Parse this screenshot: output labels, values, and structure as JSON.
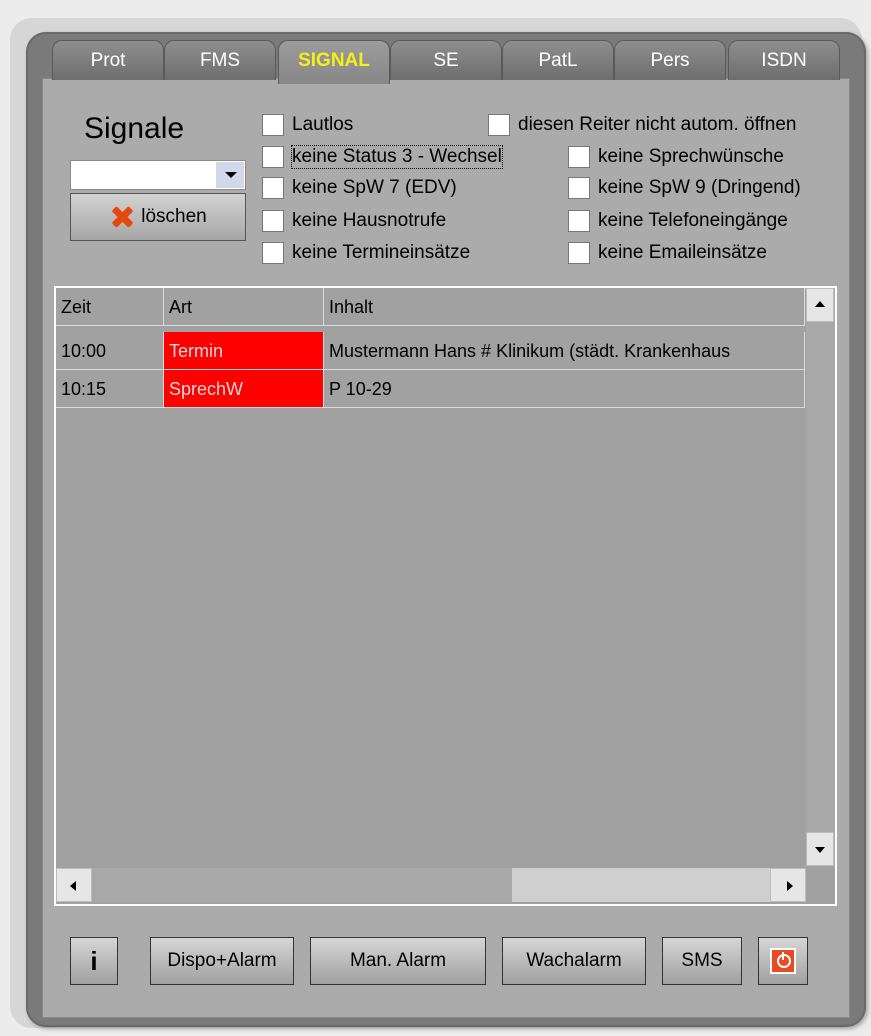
{
  "tabs": [
    "Prot",
    "FMS",
    "SIGNAL",
    "SE",
    "PatL",
    "Pers",
    "ISDN"
  ],
  "active_tab": "SIGNAL",
  "signal": {
    "title": "Signale",
    "dropdown_value": "",
    "delete_label": "löschen"
  },
  "checkboxes": {
    "lautlos": "Lautlos",
    "not_auto_open": "diesen Reiter nicht autom. öffnen",
    "no_status3": "keine Status 3 - Wechsel",
    "no_speech_req": "keine Sprechwünsche",
    "no_spw7": "keine SpW 7 (EDV)",
    "no_spw9": "keine SpW 9 (Dringend)",
    "no_home_emergency": "keine Hausnotrufe",
    "no_phone": "keine Telefoneingänge",
    "no_appointments": "keine Termineinsätze",
    "no_email": "keine Emaileinsätze"
  },
  "table": {
    "headers": [
      "Zeit",
      "Art",
      "Inhalt"
    ],
    "rows": [
      [
        "10:00",
        "Termin",
        "Mustermann Hans # Klinikum (städt. Krankenhaus"
      ],
      [
        "10:15",
        "SprechW",
        "P 10-29"
      ]
    ]
  },
  "buttons": {
    "info": "i",
    "dispo_alarm": "Dispo+Alarm",
    "man_alarm": "Man. Alarm",
    "wachalarm": "Wachalarm",
    "sms": "SMS"
  },
  "colors": {
    "active_tab_text": "#f4f018",
    "highlight_cell": "#ff0000",
    "panel": "#7a7a7a"
  }
}
